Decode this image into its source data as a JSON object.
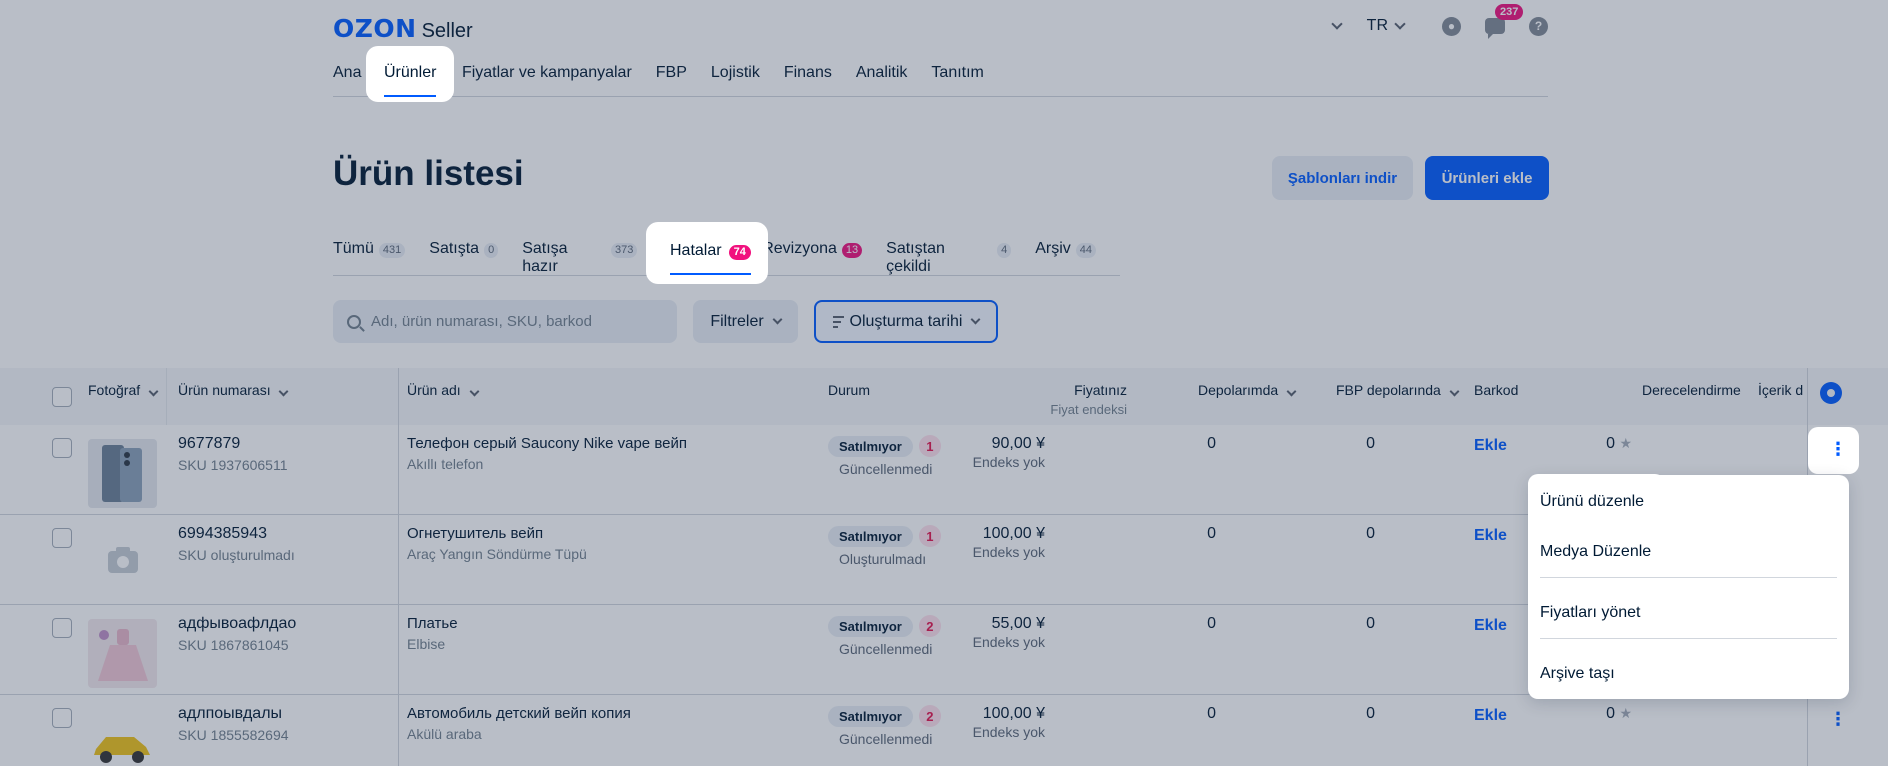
{
  "brand": {
    "logo": "OZON",
    "product": "Seller"
  },
  "header": {
    "lang": "TR",
    "notifications": "237"
  },
  "nav": [
    {
      "label": "Ana",
      "id": "ana"
    },
    {
      "label": "Ürünler",
      "id": "urunler"
    },
    {
      "label": "Fiyatlar ve kampanyalar",
      "id": "fiyatlar"
    },
    {
      "label": "FBP",
      "id": "fbp"
    },
    {
      "label": "Lojistik",
      "id": "lojistik"
    },
    {
      "label": "Finans",
      "id": "finans"
    },
    {
      "label": "Analitik",
      "id": "analitik"
    },
    {
      "label": "Tanıtım",
      "id": "tanitim"
    }
  ],
  "page": {
    "title": "Ürün listesi",
    "download_templates": "Şablonları indir",
    "add_products": "Ürünleri ekle"
  },
  "tabs": [
    {
      "label": "Tümü",
      "count": "431"
    },
    {
      "label": "Satışta",
      "count": "0"
    },
    {
      "label": "Satışa hazır",
      "count": "373"
    },
    {
      "label": "Hatalar",
      "count": "74"
    },
    {
      "label": "Revizyona",
      "count": "13"
    },
    {
      "label": "Satıştan çekildi",
      "count": "4"
    },
    {
      "label": "Arşiv",
      "count": "44"
    }
  ],
  "filters": {
    "search_placeholder": "Adı, ürün numarası, SKU, barkod",
    "filters_label": "Filtreler",
    "sort_label": "Oluşturma tarihi"
  },
  "table": {
    "headers": {
      "photo": "Fotoğraf",
      "product_number": "Ürün numarası",
      "product_name": "Ürün adı",
      "status": "Durum",
      "price": "Fiyatınız",
      "price_sub": "Fiyat endeksi",
      "depots": "Depolarımda",
      "fbp_depots": "FBP depolarında",
      "barcode": "Barkod",
      "rating": "Derecelendirme",
      "content": "İçerik d"
    },
    "rows": [
      {
        "number": "9677879",
        "sku": "SKU 1937606511",
        "name": "Телефон серый Saucony Nike vape вейп",
        "category": "Akıllı telefon",
        "status": "Satılmıyor",
        "errors": "1",
        "status_sub": "Güncellenmedi",
        "price": "90,00 ¥",
        "price_index": "Endeks yok",
        "depots": "0",
        "fbp": "0",
        "barcode": "Ekle",
        "rating": "0",
        "thumb": "phone"
      },
      {
        "number": "6994385943",
        "sku": "SKU oluşturulmadı",
        "name": "Огнетушитель вейп",
        "category": "Araç Yangın Söndürme Tüpü",
        "status": "Satılmıyor",
        "errors": "1",
        "status_sub": "Oluşturulmadı",
        "price": "100,00 ¥",
        "price_index": "Endeks yok",
        "depots": "0",
        "fbp": "0",
        "barcode": "Ekle",
        "rating": "",
        "thumb": "placeholder"
      },
      {
        "number": "адфывоафлдао",
        "sku": "SKU 1867861045",
        "name": "Платье",
        "category": "Elbise",
        "status": "Satılmıyor",
        "errors": "2",
        "status_sub": "Güncellenmedi",
        "price": "55,00 ¥",
        "price_index": "Endeks yok",
        "depots": "0",
        "fbp": "0",
        "barcode": "Ekle",
        "rating": "",
        "thumb": "dress"
      },
      {
        "number": "адлпоывдалы",
        "sku": "SKU 1855582694",
        "name": "Автомобиль детский вейп копия",
        "category": "Akülü araba",
        "status": "Satılmıyor",
        "errors": "2",
        "status_sub": "Güncellenmedi",
        "price": "100,00 ¥",
        "price_index": "Endeks yok",
        "depots": "0",
        "fbp": "0",
        "barcode": "Ekle",
        "rating": "0",
        "thumb": "car"
      }
    ]
  },
  "context_menu": [
    {
      "label": "Ürünü düzenle"
    },
    {
      "label": "Medya Düzenle"
    },
    {
      "label": "Fiyatları yönet"
    },
    {
      "label": "Arşive taşı"
    }
  ],
  "colors": {
    "accent": "#005bff",
    "badge": "#f1117e",
    "error": "#e5124d"
  }
}
